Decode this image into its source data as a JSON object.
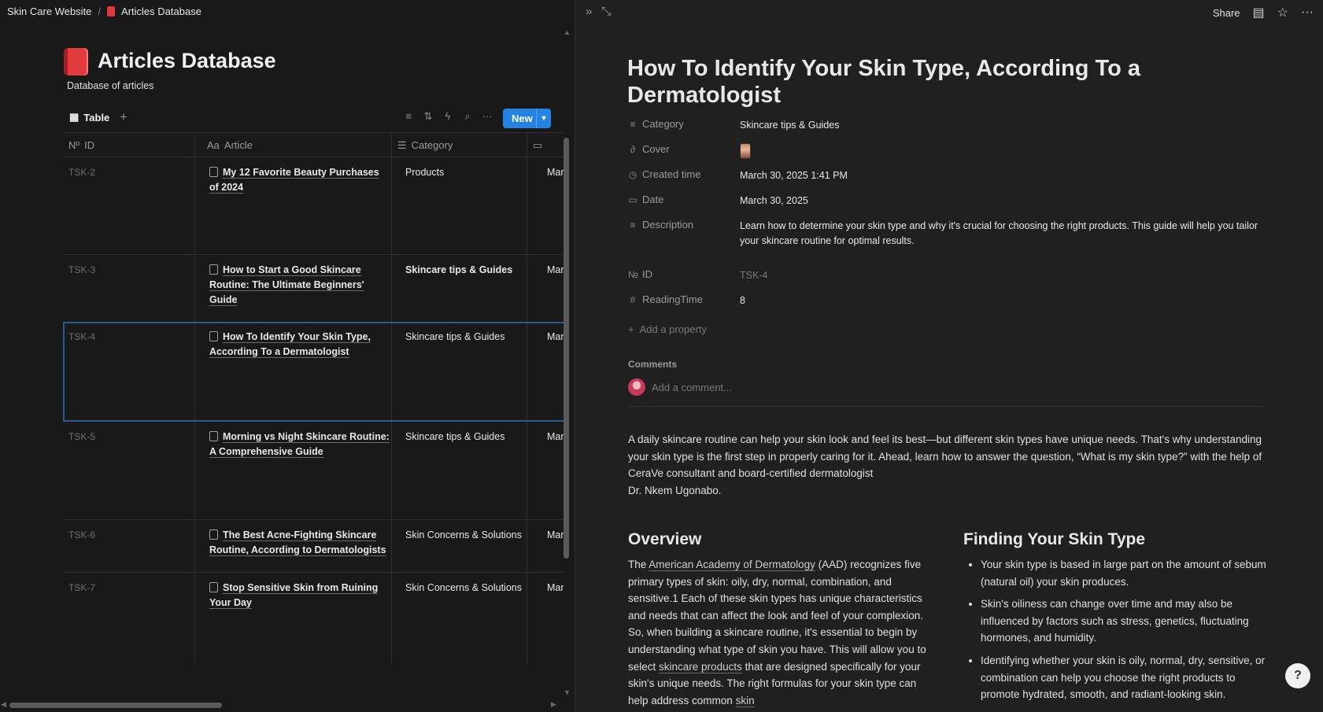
{
  "breadcrumb": {
    "workspace": "Skin Care Website",
    "separator": "/",
    "current": "Articles Database"
  },
  "database": {
    "title": "Articles Database",
    "description": "Database of articles"
  },
  "view": {
    "tab_label": "Table",
    "add_icon": "+",
    "tools": [
      "filter-icon",
      "sort-icon",
      "lightning-icon",
      "search-icon",
      "more-icon"
    ],
    "new_label": "New"
  },
  "columns": [
    {
      "icon": "Nº",
      "label": "ID"
    },
    {
      "icon": "Aa",
      "label": "Article"
    },
    {
      "icon": "☰",
      "label": "Category"
    },
    {
      "icon": "date-icon",
      "label": ""
    }
  ],
  "rows": [
    {
      "id": "TSK-2",
      "article_line1": "My 12 Favorite Beauty Purchases",
      "article_line2": "of 2024",
      "category": "Products",
      "date": "Mar"
    },
    {
      "id": "TSK-3",
      "article_line1": "How to Start a Good Skincare",
      "article_line2": "Routine: The Ultimate Beginners' Guide",
      "category": "Skincare tips & Guides",
      "date": "Mar"
    },
    {
      "id": "TSK-4",
      "article_line1": "How To Identify Your Skin Type,",
      "article_line2": "According To a Dermatologist",
      "category": "Skincare tips & Guides",
      "date": "Mar"
    },
    {
      "id": "TSK-5",
      "article_line1": "Morning vs Night Skincare Routine:",
      "article_line2": "A Comprehensive Guide",
      "category": "Skincare tips & Guides",
      "date": "Mar"
    },
    {
      "id": "TSK-6",
      "article_line1": "The Best Acne-Fighting Skincare",
      "article_line2": "Routine, According to Dermatologists",
      "category": "Skin Concerns & Solutions",
      "date": "Mar"
    },
    {
      "id": "TSK-7",
      "article_line1": "Stop Sensitive Skin from Ruining",
      "article_line2": "Your Day",
      "category": "Skin Concerns & Solutions",
      "date": "Mar"
    }
  ],
  "peek": {
    "topbar": {
      "share": "Share"
    },
    "title": "How To Identify Your Skin Type, According To a Dermatologist",
    "props": {
      "category": {
        "name": "Category",
        "value": "Skincare tips & Guides"
      },
      "cover": {
        "name": "Cover"
      },
      "created": {
        "name": "Created time",
        "value": "March 30, 2025 1:41 PM"
      },
      "date": {
        "name": "Date",
        "value": "March 30, 2025"
      },
      "description": {
        "name": "Description",
        "value": "Learn how to determine your skin type and why it's crucial for choosing the right products. This guide will help you tailor your skincare routine for optimal results."
      },
      "id": {
        "name": "ID",
        "value": "TSK-4"
      },
      "reading": {
        "name": "ReadingTime",
        "value": "8"
      }
    },
    "add_property": "Add a property",
    "comments_heading": "Comments",
    "comment_placeholder": "Add a comment...",
    "intro": "A daily skincare routine can help your skin look and feel its best—but different skin types have unique needs. That's why understanding your skin type is the first step in properly caring for it. Ahead, learn how to answer the question, “What is my skin type?” with the help of CeraVe consultant and board-certified dermatologist",
    "intro_author": "Dr. Nkem Ugonabo.",
    "overview_heading": "Overview",
    "overview": {
      "p1": "The ",
      "link1": "American Academy of Dermatology",
      "p2": " (AAD) recognizes five primary types of skin: oily, dry, normal, combination, and sensitive.1 Each of these skin types has unique characteristics and needs that can affect the look and feel of your complexion. So, when building a skincare routine, it's essential to begin by understanding what type of skin you have. This will allow you to select ",
      "link2": "skincare products",
      "p3": " that are designed specifically for your skin's unique needs. The right formulas for your skin type can help address common ",
      "link3": "skin"
    },
    "finding_heading": "Finding Your Skin Type",
    "bullets": [
      "Your skin type is based in large part on the amount of sebum (natural oil) your skin produces.",
      "Skin's oiliness can change over time and may also be influenced by factors such as stress, genetics, fluctuating hormones, and humidity.",
      "Identifying whether your skin is oily, normal, dry, sensitive, or combination can help you choose the right products to promote hydrated, smooth, and radiant-looking skin."
    ]
  },
  "colors": {
    "accent": "#2383e2",
    "bg_left": "#191919",
    "bg_right": "#202020",
    "db_icon": "#e23b3e"
  }
}
